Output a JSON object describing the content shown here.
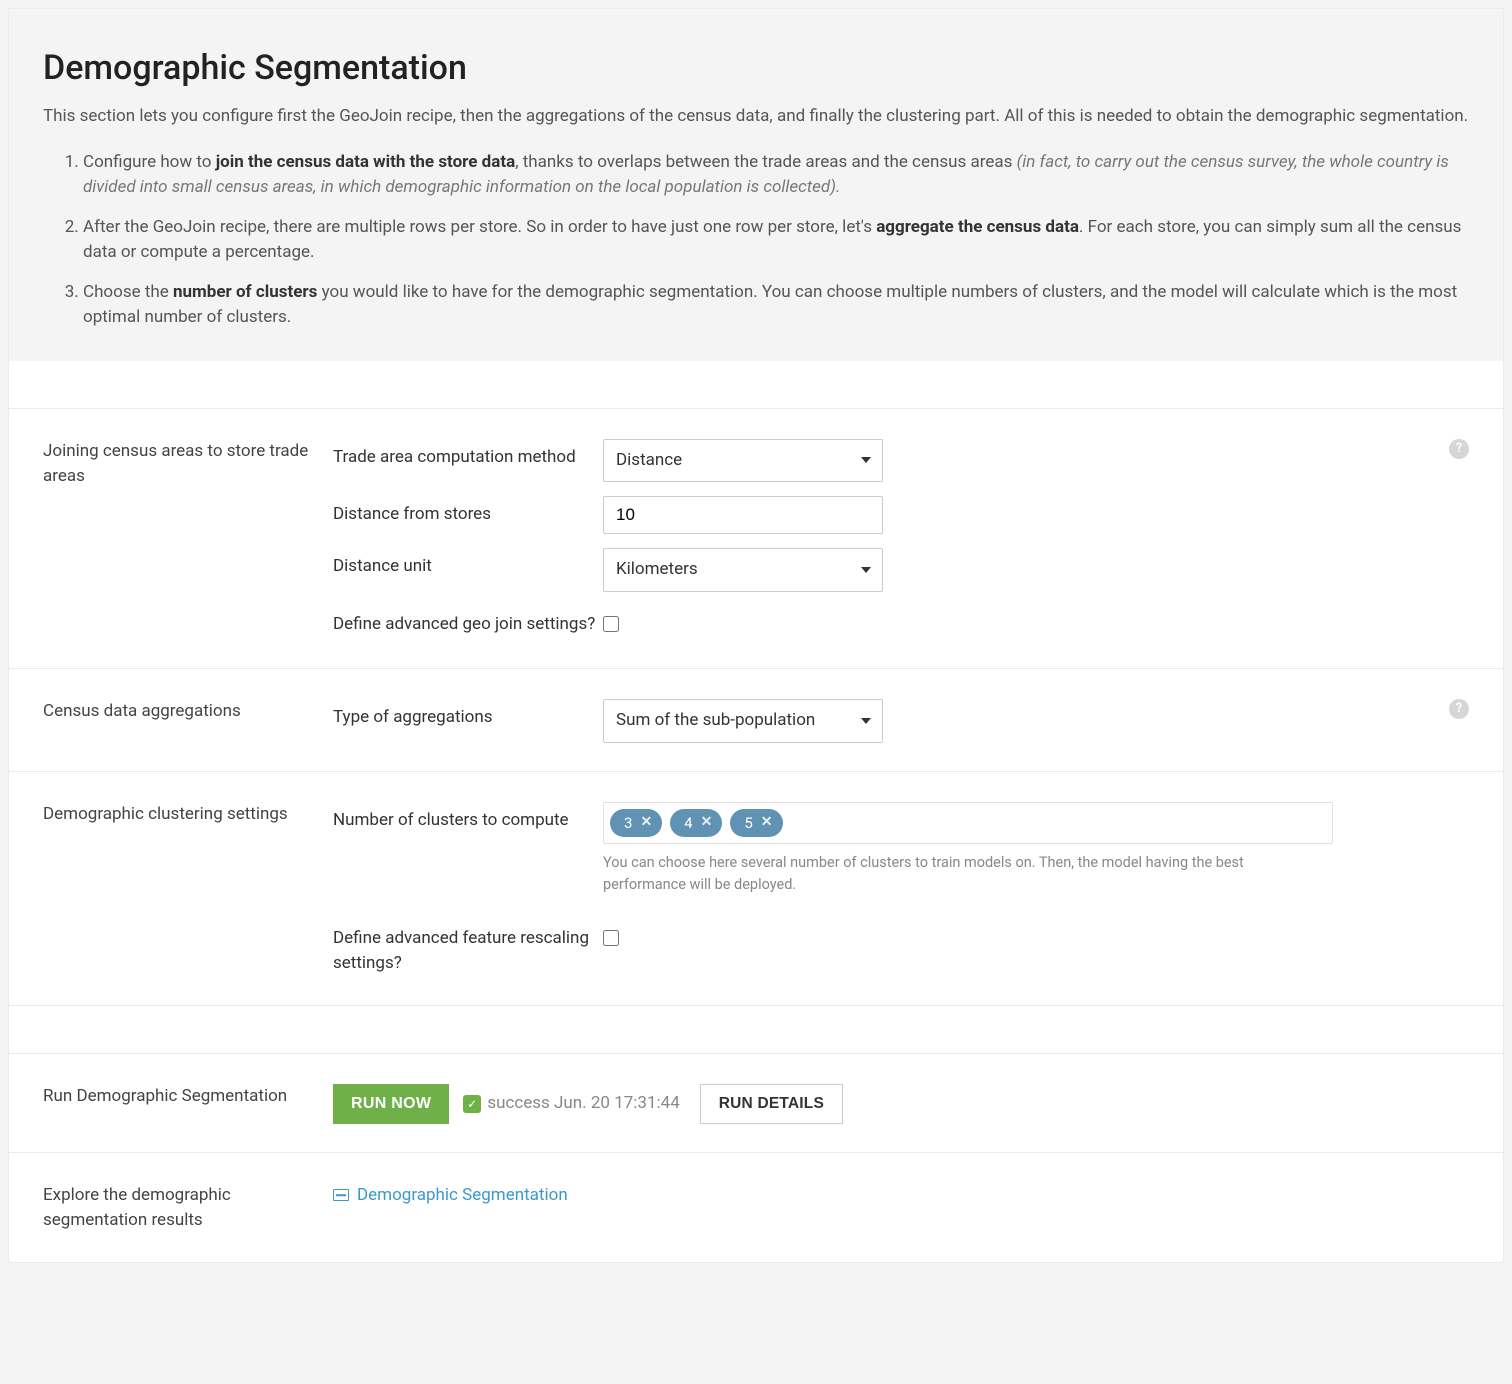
{
  "header": {
    "title": "Demographic Segmentation",
    "subtitle": "This section lets you configure first the GeoJoin recipe, then the aggregations of the census data, and finally the clustering part. All of this is needed to obtain the demographic segmentation.",
    "steps": {
      "s1_pre": "Configure how to ",
      "s1_bold": "join the census data with the store data",
      "s1_post": ", thanks to overlaps between the trade areas and the census areas ",
      "s1_em": "(in fact, to carry out the census survey, the whole country is divided into small census areas, in which demographic information on the local population is collected).",
      "s2_pre": "After the GeoJoin recipe, there are multiple rows per store. So in order to have just one row per store, let's ",
      "s2_bold": "aggregate the census data",
      "s2_post": ". For each store, you can simply sum all the census data or compute a percentage.",
      "s3_pre": "Choose the ",
      "s3_bold": "number of clusters",
      "s3_post": " you would like to have for the demographic segmentation. You can choose multiple numbers of clusters, and the model will calculate which is the most optimal number of clusters."
    }
  },
  "join": {
    "section_label": "Joining census areas to store trade areas",
    "method_label": "Trade area computation method",
    "method_value": "Distance",
    "distance_label": "Distance from stores",
    "distance_value": "10",
    "unit_label": "Distance unit",
    "unit_value": "Kilometers",
    "advanced_label": "Define advanced geo join settings?"
  },
  "agg": {
    "section_label": "Census data aggregations",
    "type_label": "Type of aggregations",
    "type_value": "Sum of the sub-population"
  },
  "cluster": {
    "section_label": "Demographic clustering settings",
    "num_label": "Number of clusters to compute",
    "tags": [
      "3",
      "4",
      "5"
    ],
    "hint": "You can choose here several number of clusters to train models on. Then, the model having the best performance will be deployed.",
    "advanced_label": "Define advanced feature rescaling settings?"
  },
  "run": {
    "section_label": "Run Demographic Segmentation",
    "button_label": "RUN NOW",
    "status_text": "success Jun. 20 17:31:44",
    "details_label": "RUN DETAILS"
  },
  "explore": {
    "section_label": "Explore the demographic segmentation results",
    "link_label": "Demographic Segmentation"
  }
}
